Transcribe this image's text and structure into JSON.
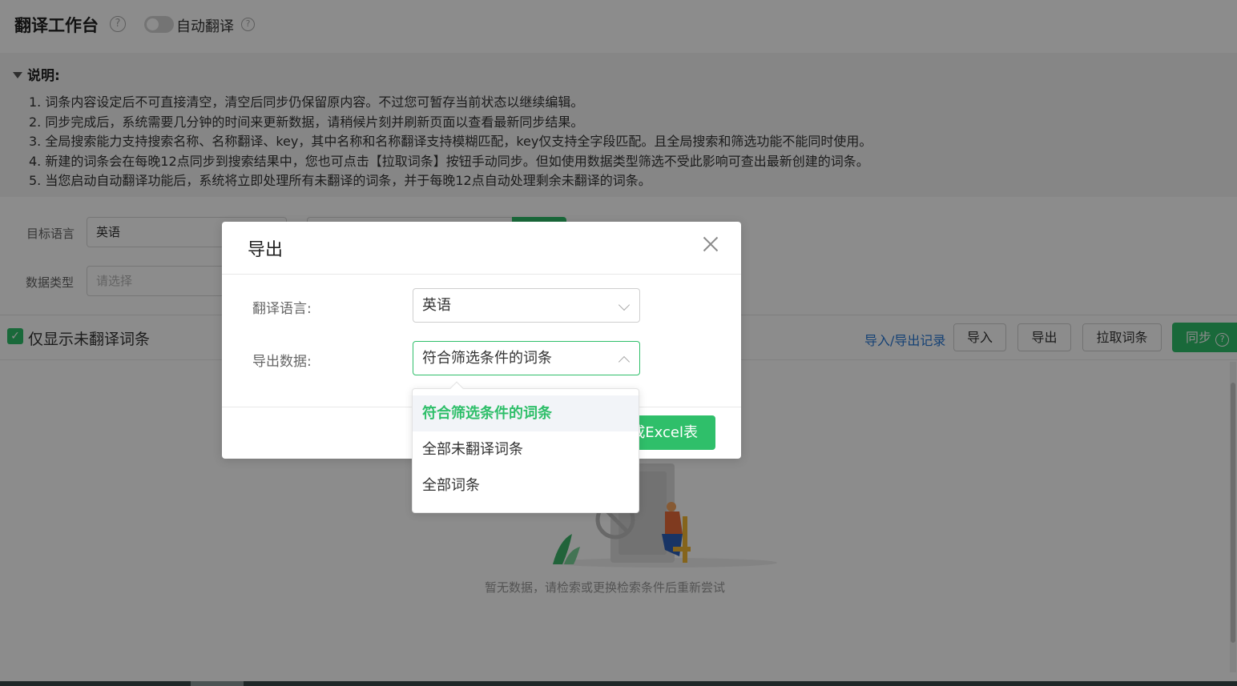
{
  "header": {
    "title": "翻译工作台",
    "help_glyph": "?",
    "auto_translate_label": "自动翻译",
    "auto_translate_on": false
  },
  "notes": {
    "heading": "说明:",
    "items": [
      "1. 词条内容设定后不可直接清空，清空后同步仍保留原内容。不过您可暂存当前状态以继续编辑。",
      "2. 同步完成后，系统需要几分钟的时间来更新数据，请稍候片刻并刷新页面以查看最新同步结果。",
      "3. 全局搜索能力支持搜索名称、名称翻译、key，其中名称和名称翻译支持模糊匹配，key仅支持全字段匹配。且全局搜索和筛选功能不能同时使用。",
      "4. 新建的词条会在每晚12点同步到搜索结果中，您也可点击【拉取词条】按钮手动同步。但如使用数据类型筛选不受此影响可查出最新创建的词条。",
      "5. 当您启动自动翻译功能后，系统将立即处理所有未翻译的词条，并于每晚12点自动处理剩余未翻译的词条。"
    ]
  },
  "filters": {
    "target_language_label": "目标语言",
    "target_language_value": "英语",
    "data_type_label": "数据类型",
    "data_type_placeholder": "请选择"
  },
  "toolbar": {
    "only_untranslated_label": "仅显示未翻译词条",
    "only_untranslated_checked": true,
    "record_link": "导入/导出记录",
    "import_label": "导入",
    "export_label": "导出",
    "pull_label": "拉取词条",
    "sync_label": "同步"
  },
  "empty": {
    "text": "暂无数据，请检索或更换检索条件后重新尝试"
  },
  "dialog": {
    "title": "导出",
    "language_label": "翻译语言:",
    "language_value": "英语",
    "data_label": "导出数据:",
    "data_value": "符合筛选条件的词条",
    "generate_label": "成Excel表",
    "options": [
      "符合筛选条件的词条",
      "全部未翻译词条",
      "全部词条"
    ],
    "selected_option": "符合筛选条件的词条"
  },
  "colors": {
    "accent": "#2fbf6a",
    "link": "#2979d6",
    "mask": "rgba(0,0,0,0.45)"
  }
}
